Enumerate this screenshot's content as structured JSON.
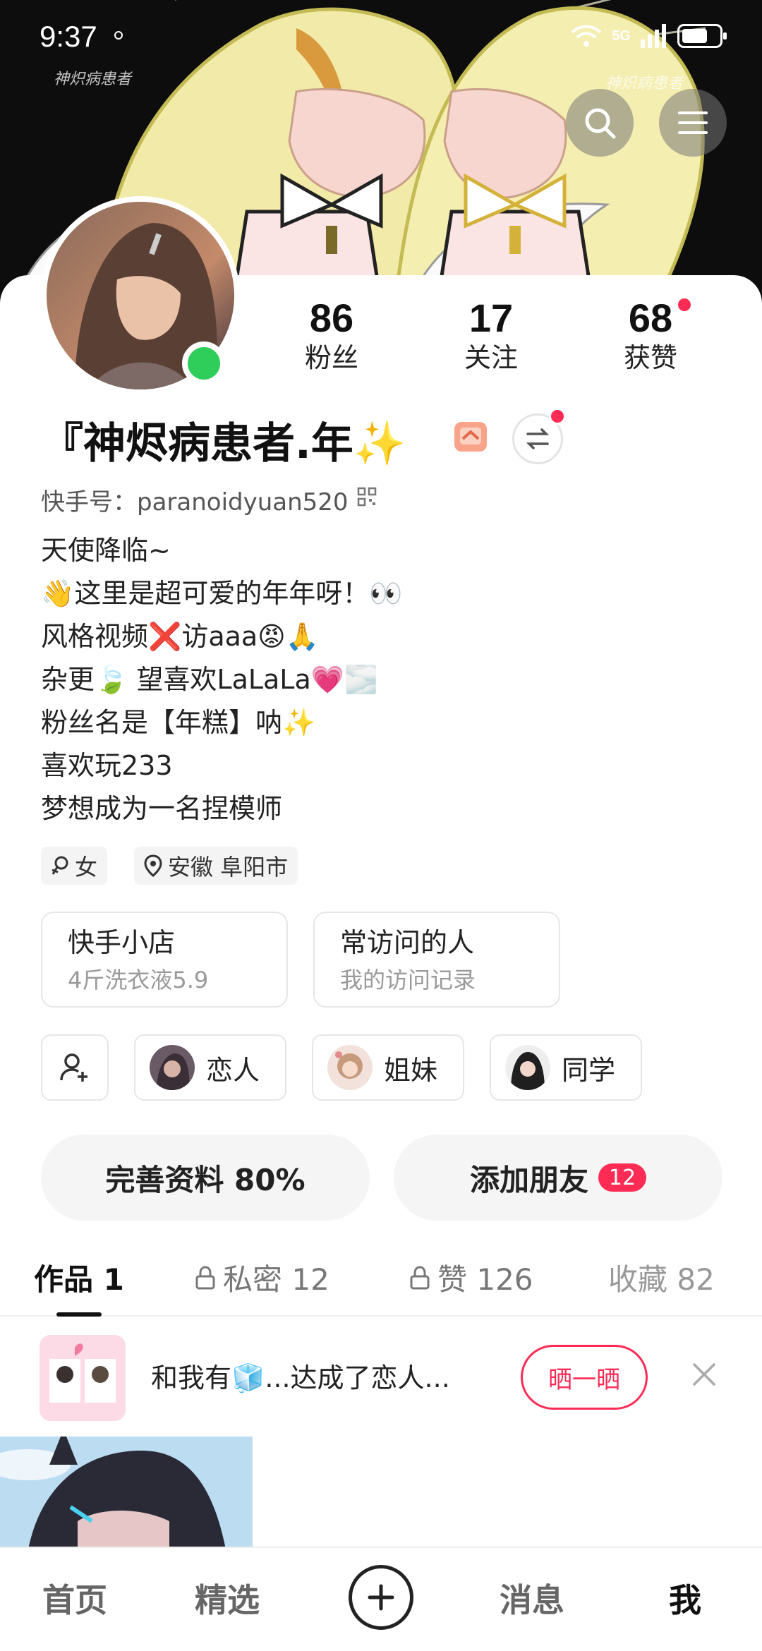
{
  "status_bar": {
    "time": "9:37",
    "network": "5G"
  },
  "header": {
    "watermark_left": "神炽病患者",
    "watermark_right": "神炽病患者",
    "search_icon": "search-icon",
    "menu_icon": "hamburger-menu-icon"
  },
  "profile": {
    "stats": [
      {
        "value": "86",
        "label": "粉丝"
      },
      {
        "value": "17",
        "label": "关注"
      },
      {
        "value": "68",
        "label": "获赞"
      }
    ],
    "name": "『神烬病患者.年✨",
    "kuaishou_id": "快手号：paranoidyuan520",
    "bio": [
      "天使降临~",
      "👋这里是超可爱的年年呀！👀",
      "风格视频❌访aaa😡🙏",
      "杂更🍃 望喜欢LaLaLa💗🌫️",
      "粉丝名是【年糕】呐✨",
      "喜欢玩233",
      "梦想成为一名捏模师"
    ],
    "tags": {
      "gender": "女",
      "location": "安徽 阜阳市"
    }
  },
  "entries": [
    {
      "title": "快手小店",
      "subtitle": "4斤洗衣液5.9"
    },
    {
      "title": "常访问的人",
      "subtitle": "我的访问记录"
    }
  ],
  "relations": [
    {
      "label": "恋人"
    },
    {
      "label": "姐妹"
    },
    {
      "label": "同学"
    }
  ],
  "actions": {
    "complete_profile": "完善资料 80%",
    "add_friends": "添加朋友",
    "add_friends_count": "12"
  },
  "tabs": [
    {
      "label": "作品 1"
    },
    {
      "label": "私密 12"
    },
    {
      "label": "赞 126"
    },
    {
      "label": "收藏 82"
    }
  ],
  "promo": {
    "text": "和我有🧊...达成了恋人...",
    "button": "晒一晒"
  },
  "bottom_nav": {
    "home": "首页",
    "select": "精选",
    "messages": "消息",
    "me": "我"
  },
  "colors": {
    "accent": "#fe2c55",
    "online": "#2fce5a"
  }
}
